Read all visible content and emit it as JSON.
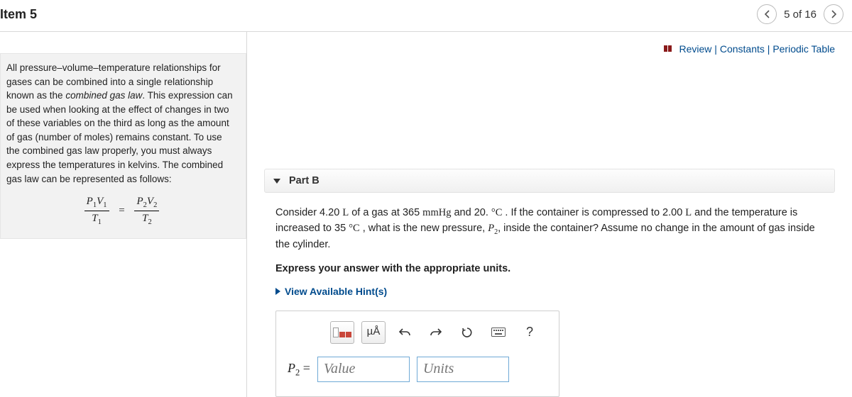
{
  "header": {
    "title": "Item 5",
    "pager": "5 of 16"
  },
  "toplinks": {
    "review": "Review",
    "constants": "Constants",
    "periodic": "Periodic Table",
    "sep": " | "
  },
  "side": {
    "text_before_em": "All pressure–volume–temperature relationships for gases can be combined into a single relationship known as the ",
    "em": "combined gas law",
    "text_after_em": ". This expression can be used when looking at the effect of changes in two of these variables on the third as long as the amount of gas (number of moles) remains constant. To use the combined gas law properly, you must always express the temperatures in kelvins. The combined gas law can be represented as follows:"
  },
  "part": {
    "title": "Part B",
    "question_1": "Consider 4.20 ",
    "q_L1": "L",
    "question_2": " of a gas at 365 ",
    "q_mmHg": "mmHg",
    "question_3": " and 20. ",
    "q_degC1": "°C",
    "question_4": " . If the container is compressed to 2.00 ",
    "q_L2": "L",
    "question_5": " and the temperature is increased to 35 ",
    "q_degC2": "°C",
    "question_6": " , what is the new pressure, ",
    "q_P2": "P",
    "q_P2sub": "2",
    "question_7": ", inside the container? Assume no change in the amount of gas inside the cylinder.",
    "instruction": "Express your answer with the appropriate units.",
    "hints": "View Available Hint(s)"
  },
  "toolbar": {
    "units_btn": "µÅ",
    "help": "?"
  },
  "answer": {
    "label_var": "P",
    "label_sub": "2",
    "label_eq": " = ",
    "value_placeholder": "Value",
    "units_placeholder": "Units"
  }
}
